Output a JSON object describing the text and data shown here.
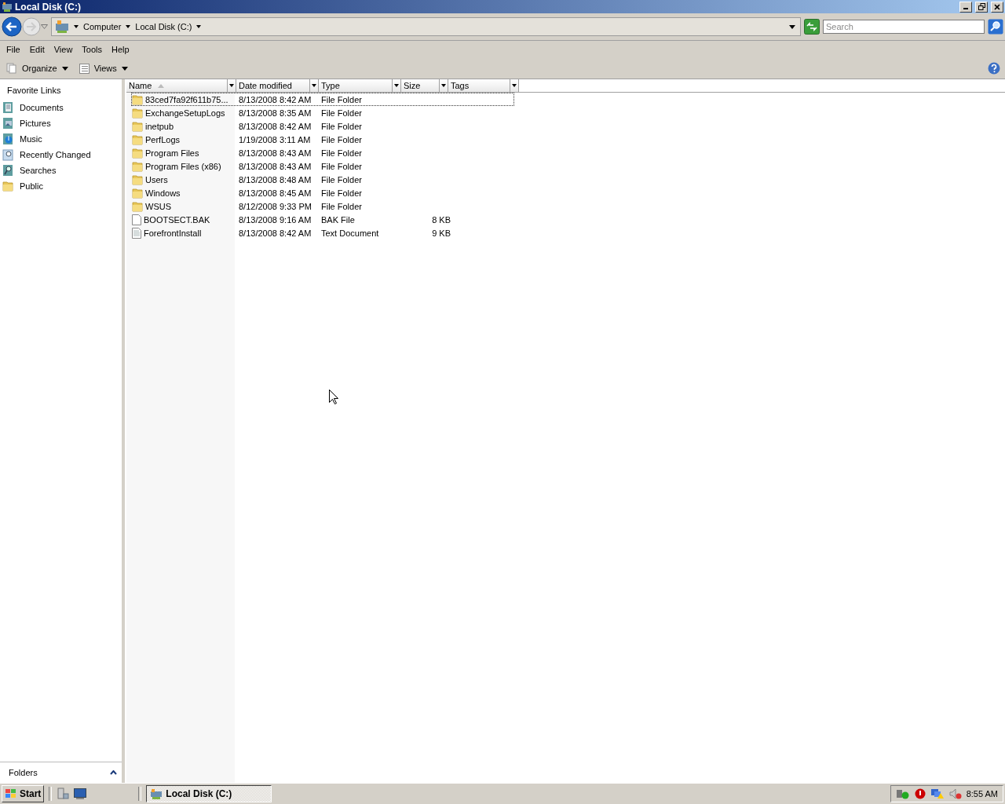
{
  "window": {
    "title": "Local Disk (C:)"
  },
  "address_bar": {
    "crumbs": [
      "Computer",
      "Local Disk (C:)"
    ],
    "search": {
      "placeholder": "Search"
    }
  },
  "menu": [
    "File",
    "Edit",
    "View",
    "Tools",
    "Help"
  ],
  "command_bar": [
    {
      "label": "Organize",
      "kind": "organize"
    },
    {
      "label": "Views",
      "kind": "views"
    }
  ],
  "sidebar": {
    "title": "Favorite Links",
    "items": [
      {
        "label": "Documents",
        "kind": "documents"
      },
      {
        "label": "Pictures",
        "kind": "pictures"
      },
      {
        "label": "Music",
        "kind": "music"
      },
      {
        "label": "Recently Changed",
        "kind": "recent"
      },
      {
        "label": "Searches",
        "kind": "searches"
      },
      {
        "label": "Public",
        "kind": "folder"
      }
    ],
    "folders_pane": {
      "label": "Folders",
      "expanded": false
    }
  },
  "table": {
    "columns": [
      {
        "label": "Name",
        "sorted": true
      },
      {
        "label": "Date modified",
        "sorted": false
      },
      {
        "label": "Type",
        "sorted": false
      },
      {
        "label": "Size",
        "sorted": false
      },
      {
        "label": "Tags",
        "sorted": false
      }
    ],
    "rows": [
      {
        "name": "83ced7fa92f611b75...",
        "date": "8/13/2008 8:42 AM",
        "type": "File Folder",
        "kind": "folder",
        "focused": true
      },
      {
        "name": "ExchangeSetupLogs",
        "date": "8/13/2008 8:35 AM",
        "type": "File Folder",
        "kind": "folder",
        "focused": false
      },
      {
        "name": "inetpub",
        "date": "8/13/2008 8:42 AM",
        "type": "File Folder",
        "kind": "folder",
        "focused": false
      },
      {
        "name": "PerfLogs",
        "date": "1/19/2008 3:11 AM",
        "type": "File Folder",
        "kind": "folder",
        "focused": false
      },
      {
        "name": "Program Files",
        "date": "8/13/2008 8:43 AM",
        "type": "File Folder",
        "kind": "folder",
        "focused": false
      },
      {
        "name": "Program Files (x86)",
        "date": "8/13/2008 8:43 AM",
        "type": "File Folder",
        "kind": "folder",
        "focused": false
      },
      {
        "name": "Users",
        "date": "8/13/2008 8:48 AM",
        "type": "File Folder",
        "kind": "folder",
        "focused": false
      },
      {
        "name": "Windows",
        "date": "8/13/2008 8:45 AM",
        "type": "File Folder",
        "kind": "folder",
        "focused": false
      },
      {
        "name": "WSUS",
        "date": "8/12/2008 9:33 PM",
        "type": "File Folder",
        "kind": "folder",
        "focused": false
      },
      {
        "name": "BOOTSECT.BAK",
        "date": "8/13/2008 9:16 AM",
        "type": "BAK File",
        "size": "8 KB",
        "kind": "file",
        "focused": false
      },
      {
        "name": "ForefrontInstall",
        "date": "8/13/2008 8:42 AM",
        "type": "Text Document",
        "size": "9 KB",
        "kind": "text",
        "focused": false
      }
    ]
  },
  "taskbar": {
    "start": "Start",
    "tasks": [
      {
        "label": "Local Disk (C:)",
        "selected": true
      }
    ],
    "clock": "8:55 AM"
  }
}
